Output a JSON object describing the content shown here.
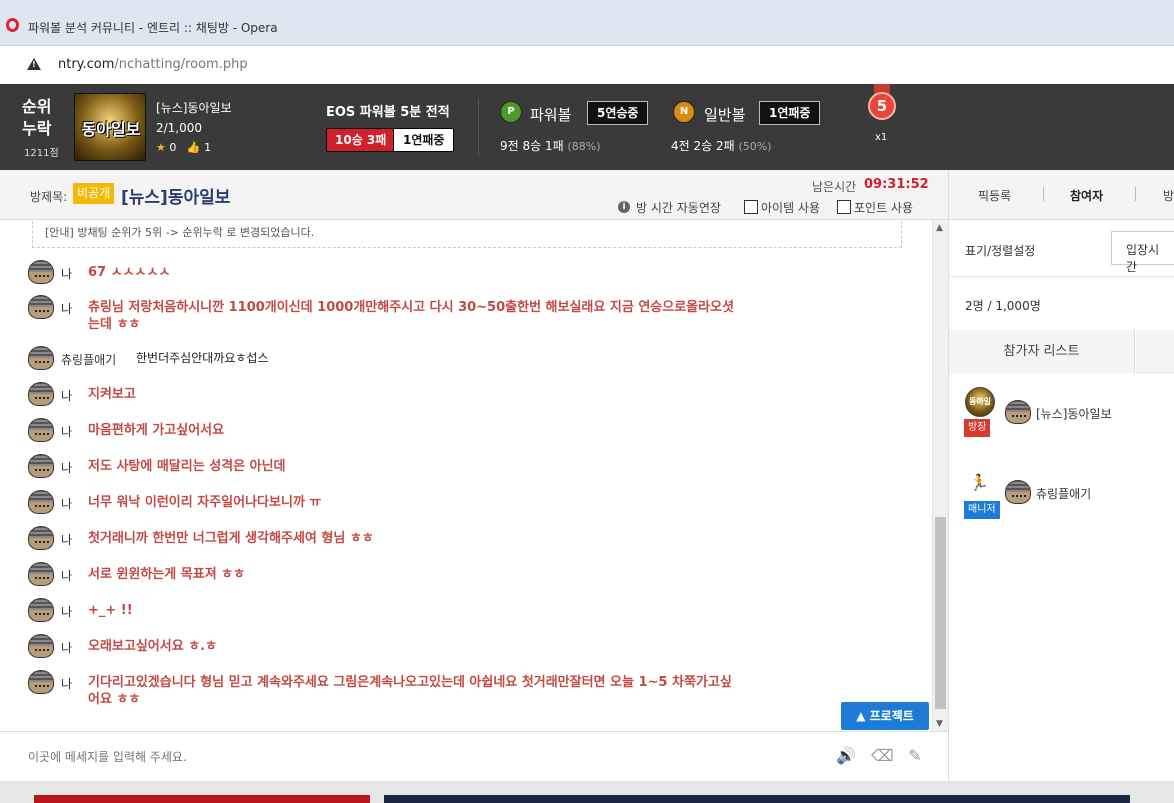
{
  "window": {
    "title": "파워볼 분석 커뮤니티 - 엔트리 :: 채팅방 - Opera"
  },
  "address": {
    "host": "ntry.com",
    "path": "/nchatting/room.php"
  },
  "header": {
    "rank_label": "순위누락",
    "rank_points": "1211점",
    "avatar_text": "동아일보",
    "room_name": "[뉴스]동아일보",
    "room_count": "2/1,000",
    "stars": "0",
    "likes": "1",
    "eos_title": "EOS 파워볼 5분 전적",
    "eos_record": "10승 3패",
    "eos_streak": "1연패중",
    "powerball": {
      "ball": "P",
      "label": "파워볼",
      "streak": "5연승중",
      "record": "9전 8승 1패",
      "pct": "(88%)"
    },
    "normalball": {
      "ball": "N",
      "label": "일반볼",
      "streak": "1연패중",
      "record": "4전 2승 2패",
      "pct": "(50%)"
    },
    "medal_number": "5",
    "medal_count": "x1"
  },
  "roombar": {
    "label": "방제목:",
    "public_badge": "비공개",
    "title": "[뉴스]동아일보",
    "remain_label": "남은시간",
    "remain_time": "09:31:52",
    "auto_extend": "방 시간 자동연장",
    "item_use": "아이템 사용",
    "point_use": "포인트 사용"
  },
  "right_tabs": {
    "pick": "픽등록",
    "participants": "참여자",
    "third": "방"
  },
  "notice": "[안내] 방채팅 순위가 5위 -> 순위누락 로 변경되었습니다.",
  "messages": [
    {
      "name": "나",
      "text": "67 ㅅㅅㅅㅅㅅ",
      "plain": false
    },
    {
      "name": "나",
      "text": "츄링님 저랑처음하시니깐 1100개이신데 1000개만해주시고 다시 30~50출한번 해보실래요 지금 연승으로올라오셧는데 ㅎㅎ",
      "plain": false
    },
    {
      "name": "츄링플애기",
      "text": "한번더주심안대까요ㅎ섭스",
      "plain": true
    },
    {
      "name": "나",
      "text": "지켜보고",
      "plain": false
    },
    {
      "name": "나",
      "text": "마음편하게 가고싶어서요",
      "plain": false
    },
    {
      "name": "나",
      "text": "저도 사탕에 매달리는 성격은 아닌데",
      "plain": false
    },
    {
      "name": "나",
      "text": "너무 워낙 이런이리 자주일어나다보니까 ㅠ",
      "plain": false
    },
    {
      "name": "나",
      "text": "첫거래니까 한번만 너그럽게 생각해주세여 형님 ㅎㅎ",
      "plain": false
    },
    {
      "name": "나",
      "text": "서로 윈윈하는게 목표져 ㅎㅎ",
      "plain": false
    },
    {
      "name": "나",
      "text": "+_+ !!",
      "plain": false
    },
    {
      "name": "나",
      "text": "오래보고싶어서요 ㅎ.ㅎ",
      "plain": false
    },
    {
      "name": "나",
      "text": "기다리고있겠습니다 형님 믿고 계속와주세요 그림은계속나오고있는데 아쉽네요 첫거래만잘터면 오늘 1~5 차쭉가고싶어요 ㅎㅎ",
      "plain": false
    }
  ],
  "protect_button": "▲ 프로젝트",
  "input": {
    "placeholder": "이곳에 메세지를 입력해 주세요."
  },
  "right_panel": {
    "sort_label": "표기/정렬설정",
    "sort_value": "입장시간",
    "count": "2명 / 1,000명",
    "list_tab": "참가자 리스트",
    "participants": [
      {
        "role": "방장",
        "name": "[뉴스]동아일보",
        "thumb": "동아일보"
      },
      {
        "role": "매니저",
        "name": "츄링플애기"
      }
    ]
  },
  "colors": {
    "header_bg": "#3a3a3a",
    "accent_red": "#d0202a",
    "message_red": "#c24a44",
    "button_blue": "#1e7bd6",
    "badge_yellow": "#f5b90a"
  }
}
